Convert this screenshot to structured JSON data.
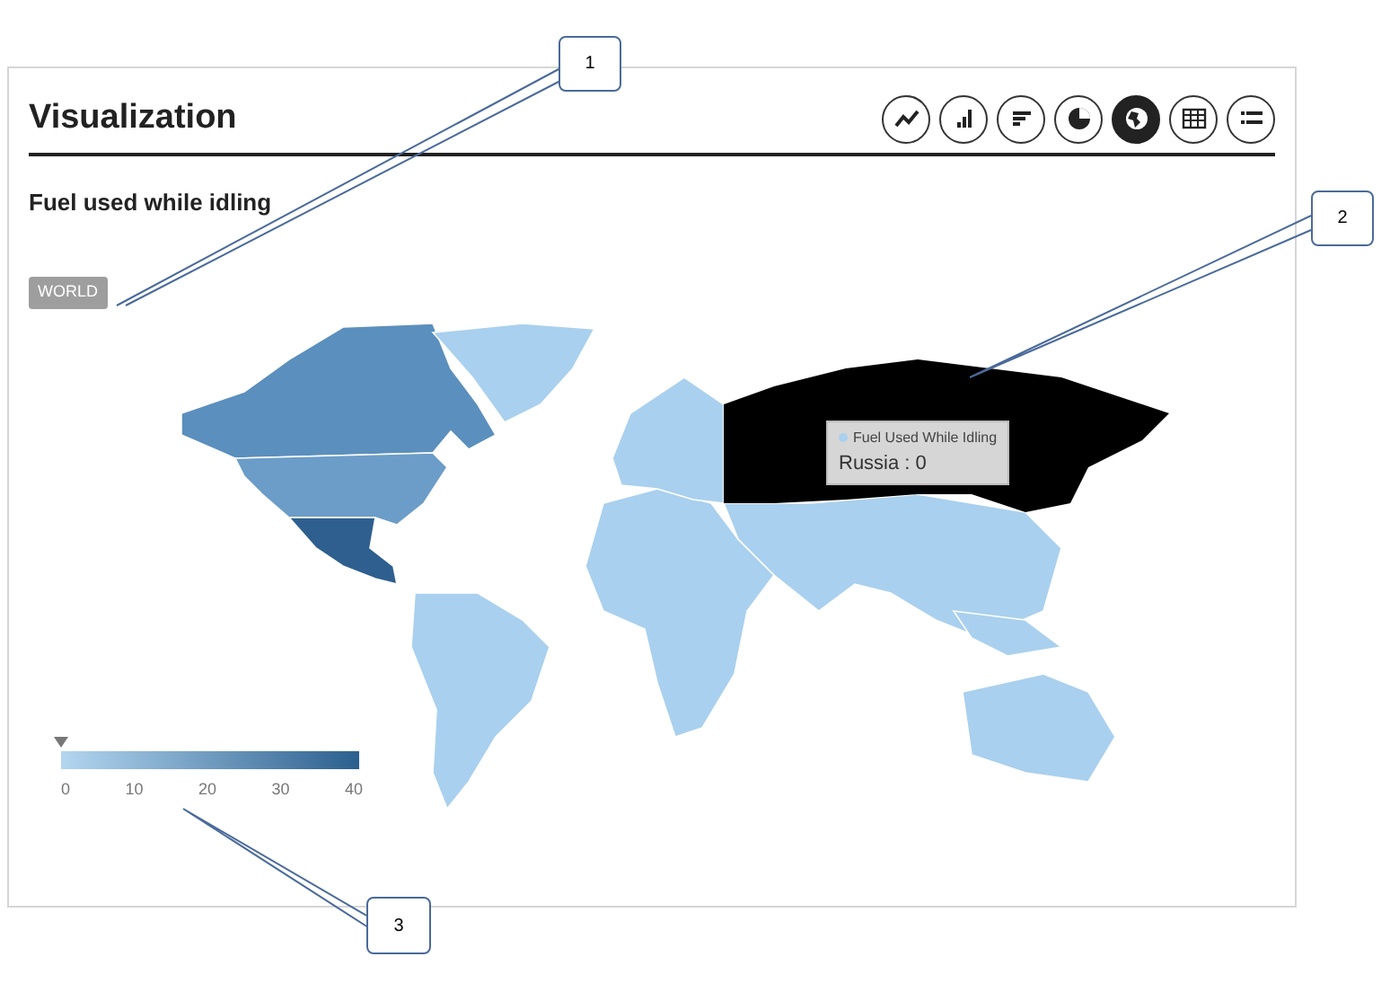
{
  "panel": {
    "title": "Visualization",
    "subtitle": "Fuel used while idling",
    "region_tag": "WORLD"
  },
  "toolbar": [
    {
      "kind": "line",
      "selected": false
    },
    {
      "kind": "bar",
      "selected": false
    },
    {
      "kind": "hbar",
      "selected": false
    },
    {
      "kind": "pie",
      "selected": false
    },
    {
      "kind": "map",
      "selected": true
    },
    {
      "kind": "table",
      "selected": false
    },
    {
      "kind": "list",
      "selected": false
    }
  ],
  "tooltip": {
    "series": "Fuel Used While Idling",
    "text": "Russia : 0"
  },
  "legend": {
    "level": 0,
    "ticks": [
      "0",
      "10",
      "20",
      "30",
      "40"
    ]
  },
  "callouts": [
    "1",
    "2",
    "3"
  ]
}
